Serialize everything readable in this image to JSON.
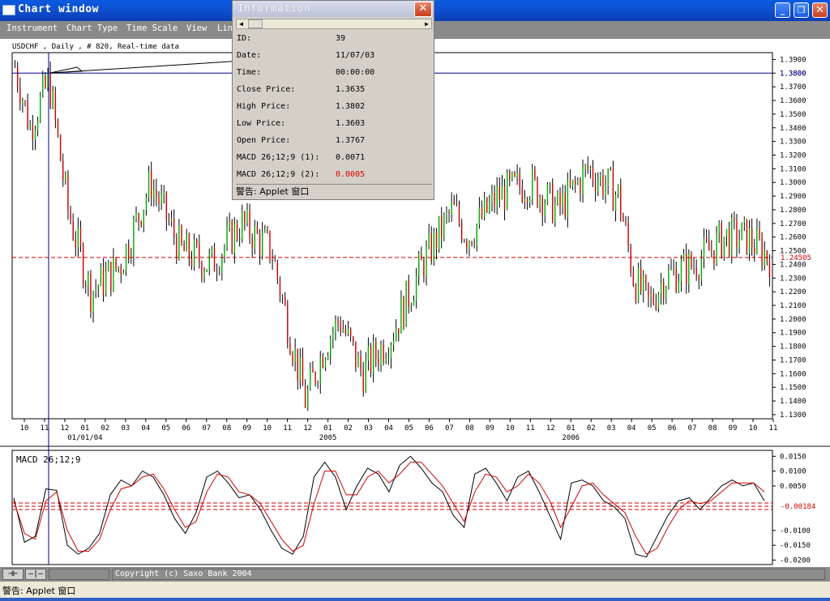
{
  "window": {
    "title": "Chart window",
    "buttons": {
      "minimize": "_",
      "restore": "❐",
      "close": "✕"
    }
  },
  "menu": [
    "Instrument",
    "Chart Type",
    "Time Scale",
    "View",
    "Lin"
  ],
  "chart": {
    "header": "USDCHF , Daily , # 820, Real-time data",
    "indicator_label": "MACD 26;12;9",
    "current_price_label": "1.24505",
    "crosshair_price_label": "1.3800",
    "macd_signal_label": "-0.00184"
  },
  "chart_data": [
    {
      "type": "candlestick",
      "title": "USDCHF , Daily , # 820, Real-time data",
      "x_ticks": [
        "10",
        "11",
        "12",
        "01",
        "02",
        "03",
        "04",
        "05",
        "06",
        "07",
        "08",
        "09",
        "10",
        "11",
        "12",
        "01",
        "02",
        "03",
        "04",
        "05",
        "06",
        "07",
        "08",
        "09",
        "10",
        "11",
        "12",
        "01",
        "02",
        "03",
        "04",
        "05",
        "06",
        "07",
        "08",
        "09",
        "10",
        "11"
      ],
      "year_labels": [
        "01/01/04",
        "2005",
        "2006"
      ],
      "y_ticks": [
        1.39,
        1.38,
        1.37,
        1.36,
        1.35,
        1.34,
        1.33,
        1.32,
        1.31,
        1.3,
        1.29,
        1.28,
        1.27,
        1.26,
        1.25,
        1.24,
        1.23,
        1.22,
        1.21,
        1.2,
        1.19,
        1.18,
        1.17,
        1.16,
        1.15,
        1.14,
        1.13
      ],
      "y_tick_labels": [
        "1.3900",
        "1.3800",
        "1.3700",
        "1.3600",
        "1.3500",
        "1.3400",
        "1.3300",
        "1.3200",
        "1.3100",
        "1.3000",
        "1.2900",
        "1.2800",
        "1.2700",
        "1.2600",
        "1.2500",
        "1.2400",
        "1.2300",
        "1.2200",
        "1.2100",
        "1.2000",
        "1.1900",
        "1.1800",
        "1.1700",
        "1.1600",
        "1.1500",
        "1.1400",
        "1.1300"
      ],
      "ylim": [
        1.127,
        1.395
      ],
      "current_price": 1.24505,
      "crosshair_price": 1.38,
      "trend": [
        [
          0,
          1.385
        ],
        [
          0.02,
          1.34
        ],
        [
          0.045,
          1.375
        ],
        [
          0.07,
          1.28
        ],
        [
          0.1,
          1.22
        ],
        [
          0.14,
          1.24
        ],
        [
          0.18,
          1.3
        ],
        [
          0.22,
          1.25
        ],
        [
          0.26,
          1.24
        ],
        [
          0.3,
          1.27
        ],
        [
          0.34,
          1.25
        ],
        [
          0.36,
          1.2
        ],
        [
          0.385,
          1.14
        ],
        [
          0.41,
          1.18
        ],
        [
          0.43,
          1.2
        ],
        [
          0.46,
          1.16
        ],
        [
          0.5,
          1.19
        ],
        [
          0.54,
          1.24
        ],
        [
          0.58,
          1.28
        ],
        [
          0.6,
          1.26
        ],
        [
          0.64,
          1.29
        ],
        [
          0.68,
          1.3
        ],
        [
          0.72,
          1.28
        ],
        [
          0.76,
          1.31
        ],
        [
          0.8,
          1.29
        ],
        [
          0.82,
          1.23
        ],
        [
          0.84,
          1.21
        ],
        [
          0.86,
          1.23
        ],
        [
          0.9,
          1.24
        ],
        [
          0.94,
          1.26
        ],
        [
          0.97,
          1.26
        ],
        [
          1.0,
          1.245
        ]
      ]
    },
    {
      "type": "line",
      "title": "MACD 26;12;9",
      "y_ticks": [
        0.015,
        0.01,
        0.005,
        -0.01,
        -0.015,
        -0.02
      ],
      "y_tick_labels": [
        "0.0150",
        "0.0100",
        "0.0050",
        "-0.0100",
        "-0.0150",
        "-0.0200"
      ],
      "ylim": [
        -0.0215,
        0.017
      ],
      "signal_level": -0.00184,
      "series": [
        {
          "values": [
            0.001,
            -0.014,
            -0.012,
            0.004,
            0.0035,
            -0.015,
            -0.018,
            -0.016,
            -0.011,
            0.002,
            0.007,
            0.005,
            0.01,
            0.008,
            0.002,
            -0.006,
            -0.011,
            -0.004,
            0.008,
            0.01,
            0.006,
            0.001,
            0.002,
            -0.003,
            -0.01,
            -0.016,
            -0.018,
            -0.012,
            0.008,
            0.013,
            0.008,
            -0.003,
            0.005,
            0.011,
            0.009,
            0.003,
            0.012,
            0.015,
            0.011,
            0.006,
            0.003,
            -0.005,
            -0.009,
            0.009,
            0.011,
            0.006,
            0.0,
            0.008,
            0.01,
            0.003,
            -0.005,
            -0.013,
            0.006,
            0.007,
            0.005,
            0.0,
            -0.002,
            -0.006,
            -0.018,
            -0.019,
            -0.012,
            -0.005,
            0.0,
            0.001,
            -0.003,
            0.001,
            0.005,
            0.007,
            0.005,
            0.006,
            0.0
          ]
        },
        {
          "values": [
            0.0,
            -0.011,
            -0.013,
            0.0,
            0.003,
            -0.01,
            -0.017,
            -0.017,
            -0.013,
            -0.003,
            0.004,
            0.005,
            0.008,
            0.009,
            0.004,
            -0.003,
            -0.009,
            -0.007,
            0.003,
            0.009,
            0.008,
            0.003,
            0.002,
            -0.001,
            -0.007,
            -0.013,
            -0.017,
            -0.015,
            -0.001,
            0.01,
            0.01,
            0.002,
            0.002,
            0.008,
            0.01,
            0.006,
            0.009,
            0.013,
            0.013,
            0.009,
            0.005,
            -0.001,
            -0.007,
            0.003,
            0.009,
            0.008,
            0.003,
            0.005,
            0.009,
            0.006,
            0.0,
            -0.009,
            -0.002,
            0.005,
            0.006,
            0.002,
            -0.001,
            -0.004,
            -0.012,
            -0.018,
            -0.016,
            -0.009,
            -0.003,
            0.0,
            -0.001,
            0.0,
            0.003,
            0.006,
            0.006,
            0.006,
            0.003
          ]
        }
      ]
    }
  ],
  "info_popup": {
    "title": "Information",
    "close_label": "✕",
    "rows": [
      {
        "label": "ID:",
        "value": "39"
      },
      {
        "label": "Date:",
        "value": "11/07/03"
      },
      {
        "label": "Time:",
        "value": "00:00:00"
      },
      {
        "label": "Close Price:",
        "value": "1.3635"
      },
      {
        "label": "High Price:",
        "value": "1.3802"
      },
      {
        "label": "Low Price:",
        "value": "1.3603"
      },
      {
        "label": "Open Price:",
        "value": "1.3767"
      },
      {
        "label": "MACD 26;12;9 (1):",
        "value": "0.0071"
      },
      {
        "label": "MACD 26;12;9 (2):",
        "value": "0.0005"
      }
    ],
    "warning": "警告: Applet 窗口"
  },
  "statusbar": {
    "copyright": "Copyright (c) Saxo Bank 2004",
    "buttons": [
      "⊣⊢",
      "—|—"
    ]
  },
  "applet_warning": "警告: Applet 窗口"
}
